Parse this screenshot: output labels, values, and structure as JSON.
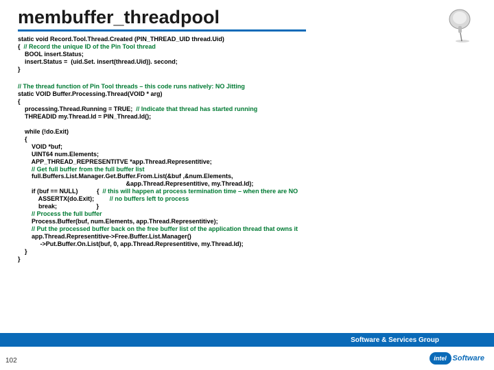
{
  "title": "membuffer_threadpool",
  "code1": {
    "l0": "static void Record.Tool.Thread.Created (PIN_THREAD_UID thread.Uid)",
    "l1a": "{  ",
    "l1b": "// Record the unique ID of the Pin Tool thread",
    "l2": "    BOOL insert.Status;",
    "l3": "    insert.Status =  (uid.Set. insert(thread.Uid)). second;",
    "l4": "}"
  },
  "code2": {
    "l0": "// The thread function of Pin Tool threads – this code runs natively: NO Jitting",
    "l1": "static VOID Buffer.Processing.Thread(VOID * arg)",
    "l2": "{",
    "l3a": "    processing.Thread.Running = TRUE;  ",
    "l3b": "// Indicate that thread has started running",
    "l4": "    THREADID my.Thread.Id = PIN_Thread.Id();",
    "l5": "    while (!do.Exit)",
    "l6": "    {",
    "l7": "        VOID *buf;",
    "l8": "        UINT64 num.Elements;",
    "l9": "        APP_THREAD_REPRESENTITVE *app.Thread.Representitive;",
    "l10": "        // Get full buffer from the full buffer list",
    "l11": "        full.Buffers.List.Manager.Get.Buffer.From.List(&buf ,&num.Elements,",
    "l12": "                                                               &app.Thread.Representitive, my.Thread.Id);",
    "l13a": "        if (buf == NULL)           {  ",
    "l13b": "// this will happen at process termination time – when there are NO",
    "l14a": "            ASSERTX(do.Exit);         ",
    "l14b": "// no buffers left to process",
    "l15": "            break;                       }",
    "l16": "        // Process the full buffer",
    "l17": "        Process.Buffer(buf, num.Elements, app.Thread.Representitive);",
    "l18": "        // Put the processed buffer back on the free buffer list of the application thread that owns it",
    "l19": "        app.Thread.Representitive->Free.Buffer.List.Manager()",
    "l20": "             ->Put.Buffer.On.List(buf, 0, app.Thread.Representitive, my.Thread.Id);",
    "l21": "    }",
    "l22": "}"
  },
  "footer": {
    "group": "Software & Services Group",
    "logo": "intel",
    "tag": "Software",
    "page": "102"
  }
}
